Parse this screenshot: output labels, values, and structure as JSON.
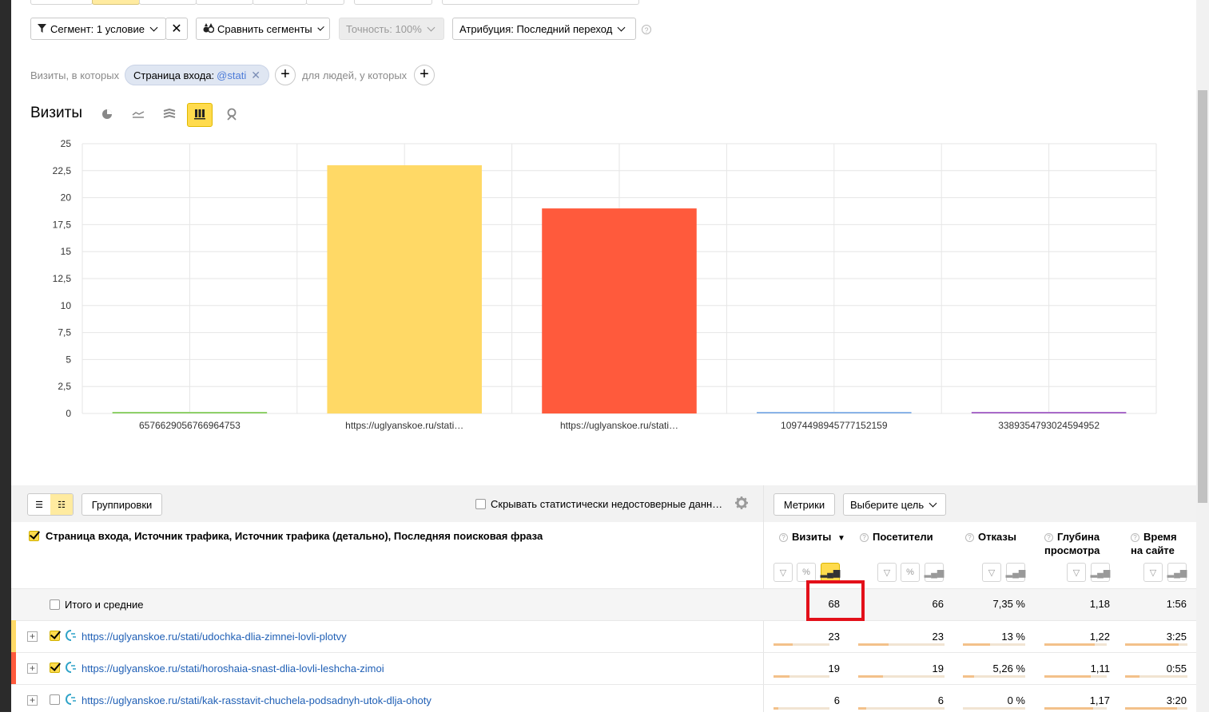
{
  "filters": {
    "segment_label": "Сегмент: 1 условие",
    "compare_label": "Сравнить сегменты",
    "accuracy_label": "Точность: 100%",
    "attribution_label": "Атрибуция: Последний переход"
  },
  "segment_builder": {
    "prefix": "Визиты, в которых",
    "chip_key": "Страница входа:",
    "chip_value": "@stati",
    "people_text": "для людей, у которых"
  },
  "chart_title": "Визиты",
  "chart_data": {
    "type": "bar",
    "categories": [
      "6576629056766964753",
      "https://uglyanskoe.ru/stati…",
      "https://uglyanskoe.ru/stati…",
      "10974498945777152159",
      "3389354793024594952"
    ],
    "values": [
      0.1,
      23,
      19,
      0.1,
      0.1
    ],
    "colors": [
      "#8fd16a",
      "#ffd966",
      "#ff5a3c",
      "#8ab4e8",
      "#a96bc9"
    ],
    "ylim": [
      0,
      25
    ],
    "yticks": [
      "0",
      "2,5",
      "5",
      "7,5",
      "10",
      "12,5",
      "15",
      "17,5",
      "20",
      "22,5",
      "25"
    ],
    "grid": true
  },
  "toolbar": {
    "groupings_label": "Группировки",
    "hide_unreliable_label": "Скрывать статистически недостоверные данн…",
    "metrics_label": "Метрики",
    "goal_label": "Выберите цель"
  },
  "table": {
    "dimensions_header": "Страница входа, Источник трафика, Источник трафика (детально), Последняя поисковая фраза",
    "columns": [
      {
        "label": "Визиты",
        "sort": "▼"
      },
      {
        "label": "Посетители"
      },
      {
        "label": "Отказы"
      },
      {
        "label": "Глубина",
        "label2": "просмотра"
      },
      {
        "label": "Время",
        "label2": "на сайте"
      }
    ],
    "total": {
      "label": "Итого и средние",
      "values": [
        "68",
        "66",
        "7,35 %",
        "1,18",
        "1:56"
      ]
    },
    "rows": [
      {
        "url": "https://uglyanskoe.ru/stati/udochka-dlia-zimnei-lovli-plotvy",
        "color": "#ffd966",
        "checked": true,
        "values": [
          "23",
          "23",
          "13 %",
          "1,22",
          "3:25"
        ]
      },
      {
        "url": "https://uglyanskoe.ru/stati/horoshaia-snast-dlia-lovli-leshcha-zimoi",
        "color": "#ff5a3c",
        "checked": true,
        "values": [
          "19",
          "19",
          "5,26 %",
          "1,11",
          "0:55"
        ]
      },
      {
        "url": "https://uglyanskoe.ru/stati/kak-rasstavit-chuchela-podsadnyh-utok-dlja-ohoty",
        "color": "",
        "checked": false,
        "values": [
          "6",
          "6",
          "0 %",
          "1,17",
          "3:20"
        ]
      }
    ]
  }
}
